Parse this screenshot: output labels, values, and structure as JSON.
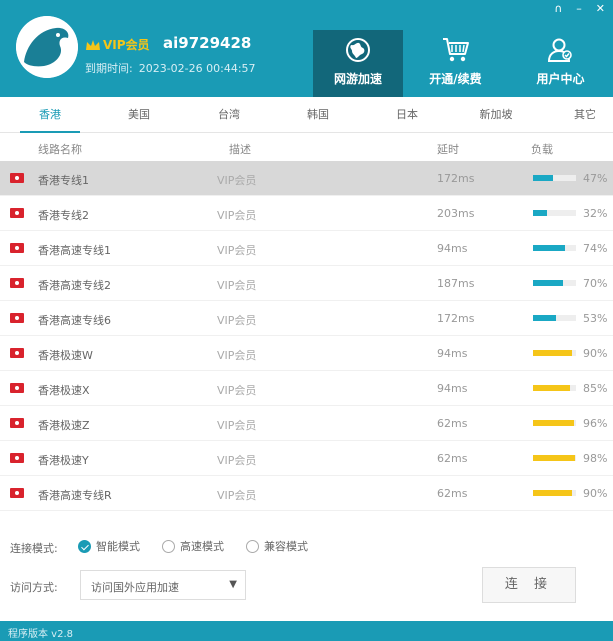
{
  "window": {
    "controls": [
      "∩",
      "–",
      "✕"
    ]
  },
  "user": {
    "vip_label": "VIP会员",
    "username": "ai9729428",
    "expire_label": "到期时间:",
    "expire_value": "2023-02-26 00:44:57"
  },
  "nav": [
    {
      "label": "网游加速",
      "icon": "globe-icon"
    },
    {
      "label": "开通/续费",
      "icon": "cart-icon"
    },
    {
      "label": "用户中心",
      "icon": "user-icon"
    }
  ],
  "tabs": [
    "香港",
    "美国",
    "台湾",
    "韩国",
    "日本",
    "新加坡",
    "其它"
  ],
  "columns": {
    "name": "线路名称",
    "desc": "描述",
    "latency": "延时",
    "load": "负载"
  },
  "colors": {
    "accent": "#1a9bb5",
    "load_low": "#1aa8c4",
    "load_high": "#f5c518"
  },
  "rows": [
    {
      "name": "香港专线1",
      "desc": "VIP会员",
      "latency": "172ms",
      "load": 47
    },
    {
      "name": "香港专线2",
      "desc": "VIP会员",
      "latency": "203ms",
      "load": 32
    },
    {
      "name": "香港高速专线1",
      "desc": "VIP会员",
      "latency": "94ms",
      "load": 74
    },
    {
      "name": "香港高速专线2",
      "desc": "VIP会员",
      "latency": "187ms",
      "load": 70
    },
    {
      "name": "香港高速专线6",
      "desc": "VIP会员",
      "latency": "172ms",
      "load": 53
    },
    {
      "name": "香港极速W",
      "desc": "VIP会员",
      "latency": "94ms",
      "load": 90
    },
    {
      "name": "香港极速X",
      "desc": "VIP会员",
      "latency": "94ms",
      "load": 85
    },
    {
      "name": "香港极速Z",
      "desc": "VIP会员",
      "latency": "62ms",
      "load": 96
    },
    {
      "name": "香港极速Y",
      "desc": "VIP会员",
      "latency": "62ms",
      "load": 98
    },
    {
      "name": "香港高速专线R",
      "desc": "VIP会员",
      "latency": "62ms",
      "load": 90
    }
  ],
  "modes": {
    "label": "连接模式:",
    "options": [
      "智能模式",
      "高速模式",
      "兼容模式"
    ],
    "selected": "智能模式"
  },
  "access": {
    "label": "访问方式:",
    "value": "访问国外应用加速"
  },
  "connect_label": "连 接",
  "footer": {
    "version": "程序版本 v2.8"
  }
}
